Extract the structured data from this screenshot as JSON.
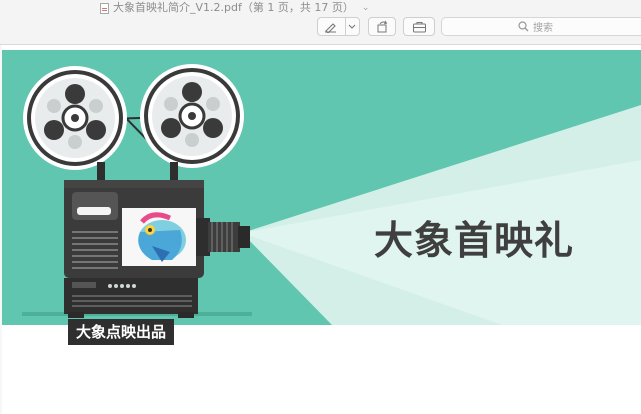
{
  "window": {
    "doc_title": "大象首映礼简介_V1.2.pdf（第 1 页，共 17 页）"
  },
  "toolbar": {
    "search_placeholder": "搜索",
    "icons": [
      "pdf-file-icon",
      "chevron-down-icon",
      "markup-pen-icon",
      "rotate-icon",
      "toolbox-icon",
      "search-icon"
    ]
  },
  "slide": {
    "title": "大象首映礼",
    "label": "大象点映出品"
  },
  "colors": {
    "banner_teal": "#60c6b0",
    "beam": "#d9f1eb",
    "projector_body": "#3b3b3b",
    "title_text": "#3f3f3f",
    "label_bg": "#2f2f2f"
  }
}
